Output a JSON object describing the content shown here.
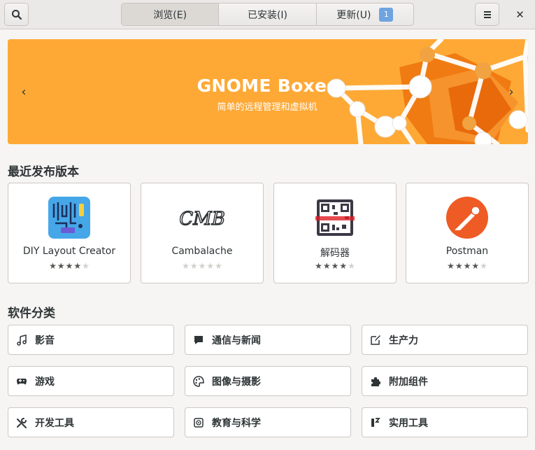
{
  "header": {
    "tabs": [
      {
        "label": "浏览(E)",
        "active": true
      },
      {
        "label": "已安装(I)",
        "active": false
      },
      {
        "label": "更新(U)",
        "active": false
      }
    ],
    "updates_count": "1",
    "close_glyph": "✕"
  },
  "banner": {
    "title": "GNOME Boxes",
    "subtitle": "简单的远程管理和虚拟机",
    "prev_glyph": "‹",
    "next_glyph": "›",
    "background_color": "#fea936"
  },
  "recent": {
    "title": "最近发布版本",
    "apps": [
      {
        "name": "DIY Layout Creator",
        "rating": 4,
        "icon": "diy-layout-creator-icon"
      },
      {
        "name": "Cambalache",
        "rating": 0,
        "icon": "cambalache-icon"
      },
      {
        "name": "解码器",
        "rating": 4,
        "icon": "decoder-qr-icon"
      },
      {
        "name": "Postman",
        "rating": 4,
        "icon": "postman-icon"
      }
    ]
  },
  "categories": {
    "title": "软件分类",
    "items": [
      {
        "label": "影音",
        "icon": "music-icon"
      },
      {
        "label": "通信与新闻",
        "icon": "chat-icon"
      },
      {
        "label": "生产力",
        "icon": "edit-icon"
      },
      {
        "label": "游戏",
        "icon": "gamepad-icon"
      },
      {
        "label": "图像与摄影",
        "icon": "palette-icon"
      },
      {
        "label": "附加组件",
        "icon": "puzzle-icon"
      },
      {
        "label": "开发工具",
        "icon": "tools-icon"
      },
      {
        "label": "教育与科学",
        "icon": "science-icon"
      },
      {
        "label": "实用工具",
        "icon": "utilities-icon"
      }
    ]
  },
  "star_glyph": "★"
}
